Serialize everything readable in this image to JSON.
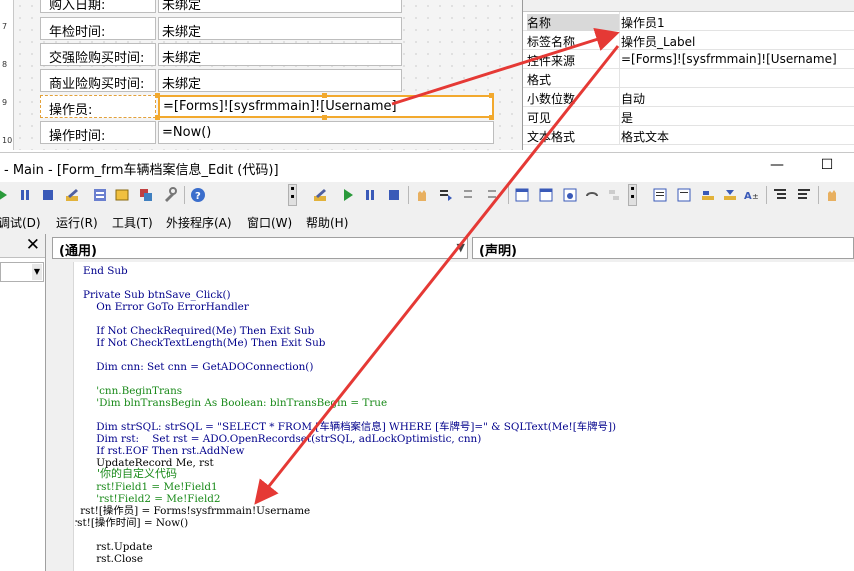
{
  "form": {
    "ruler_numbers": [
      "7",
      "8",
      "9",
      "10"
    ],
    "rows": [
      {
        "label": "购入日期:",
        "value": "未绑定"
      },
      {
        "label": "年检时间:",
        "value": "未绑定"
      },
      {
        "label": "交强险购买时间:",
        "value": "未绑定"
      },
      {
        "label": "商业险购买时间:",
        "value": "未绑定"
      },
      {
        "label": "操作员:",
        "value": "=[Forms]![sysfrmmain]![Username]"
      },
      {
        "label": "操作时间:",
        "value": "=Now()"
      }
    ]
  },
  "properties": {
    "rows": [
      {
        "key": "名称",
        "value": "操作员1"
      },
      {
        "key": "标签名称",
        "value": "操作员_Label"
      },
      {
        "key": "控件来源",
        "value": "=[Forms]![sysfrmmain]![Username]"
      },
      {
        "key": "格式",
        "value": ""
      },
      {
        "key": "小数位数",
        "value": "自动"
      },
      {
        "key": "可见",
        "value": "是"
      },
      {
        "key": "文本格式",
        "value": "格式文本"
      }
    ]
  },
  "vbe": {
    "title": "- Main - [Form_frm车辆档案信息_Edit (代码)]",
    "minimize_glyph": "—",
    "maximize_glyph": "☐",
    "menus": [
      "调试(D)",
      "运行(R)",
      "工具(T)",
      "外接程序(A)",
      "窗口(W)",
      "帮助(H)"
    ],
    "project_close_glyph": "✕",
    "object_combo": "(通用)",
    "proc_combo": "(声明)",
    "combo_arrow": "▼"
  },
  "code": {
    "lines": [
      "End Sub",
      "",
      "Private Sub btnSave_Click()",
      "    On Error GoTo ErrorHandler",
      "",
      "    If Not CheckRequired(Me) Then Exit Sub",
      "    If Not CheckTextLength(Me) Then Exit Sub",
      "",
      "    Dim cnn: Set cnn = GetADOConnection()",
      "",
      "    'cnn.BeginTrans",
      "    'Dim blnTransBegin As Boolean: blnTransBegin = True",
      "",
      "    Dim strSQL: strSQL = \"SELECT * FROM [车辆档案信息] WHERE [车牌号]=\" & SQLText(Me![车牌号])",
      "    Dim rst:    Set rst = ADO.OpenRecordset(strSQL, adLockOptimistic, cnn)",
      "    If rst.EOF Then rst.AddNew",
      "    UpdateRecord Me, rst",
      "    '你的自定义代码",
      "    rst!Field1 = Me!Field1",
      "    'rst!Field2 = Me!Field2",
      "    rst![操作员] = Forms!sysfrmmain!Username",
      "    rst![操作时间] = Now()",
      "",
      "    rst.Update",
      "    rst.Close"
    ]
  }
}
